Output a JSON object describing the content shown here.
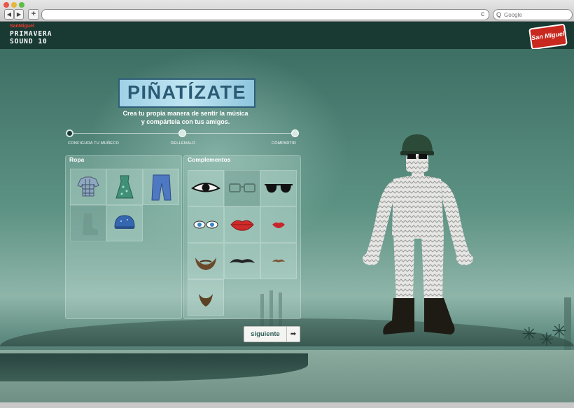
{
  "browser": {
    "back_glyph": "◀",
    "forward_glyph": "▶",
    "newtab_glyph": "+",
    "reload_glyph": "c",
    "search_placeholder": "Google",
    "search_glyph": "Q"
  },
  "header": {
    "brand_small_a": "San",
    "brand_small_b": "Miguel",
    "festival_line1": "PRIMAVERA",
    "festival_line2": "SOUND 10",
    "logo_text": "San Miguel"
  },
  "hero": {
    "title": "PIÑATÍZATE",
    "subtitle_line1": "Crea tu propia manera de sentir la música",
    "subtitle_line2": "y compártela con tus amigos."
  },
  "steps": [
    {
      "label": "CONFIGURA TU MUÑECO"
    },
    {
      "label": "RELLÉNALO"
    },
    {
      "label": "COMPARTIR"
    }
  ],
  "panels": {
    "ropa_title": "Ropa",
    "complementos_title": "Complementos"
  },
  "ropa_items": [
    "shirt-item",
    "dress-item",
    "jeans-item",
    "boot-item",
    "cap-item"
  ],
  "complementos_items": [
    "eye-item",
    "glasses-item",
    "sunglasses-item",
    "blue-eyes-item",
    "red-lips-item",
    "small-lips-item",
    "beard-item",
    "mustache-item",
    "small-mustache-item",
    "goatee-item"
  ],
  "actions": {
    "next_label": "siguiente",
    "next_arrow": "➡"
  },
  "colors": {
    "header_bg": "#183a33",
    "accent": "#2f5e55",
    "brand_red": "#c8281e"
  }
}
